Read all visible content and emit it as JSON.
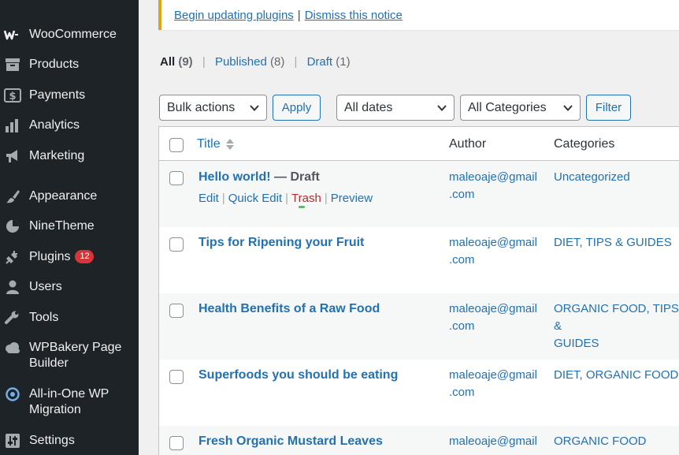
{
  "sidebar": {
    "items": [
      {
        "label": "WooCommerce",
        "icon": "woocommerce-icon"
      },
      {
        "label": "Products",
        "icon": "archive-icon"
      },
      {
        "label": "Payments",
        "icon": "dollar-icon"
      },
      {
        "label": "Analytics",
        "icon": "chart-bar-icon"
      },
      {
        "label": "Marketing",
        "icon": "megaphone-icon"
      },
      {
        "label": "Appearance",
        "icon": "paintbrush-icon"
      },
      {
        "label": "NineTheme",
        "icon": "pie-chart-icon"
      },
      {
        "label": "Plugins",
        "icon": "plugin-icon",
        "badge": "12"
      },
      {
        "label": "Users",
        "icon": "users-icon"
      },
      {
        "label": "Tools",
        "icon": "wrench-icon"
      },
      {
        "label": "WPBakery Page Builder",
        "label_line1": "WPBakery Page",
        "label_line2": "Builder",
        "icon": "cloud-icon"
      },
      {
        "label": "All-in-One WP Migration",
        "label_line1": "All-in-One WP",
        "label_line2": "Migration",
        "icon": "migration-icon"
      },
      {
        "label": "Settings",
        "icon": "settings-sliders-icon"
      }
    ]
  },
  "notice": {
    "update_link": "Begin updating plugins",
    "separator": "|",
    "dismiss_link": "Dismiss this notice"
  },
  "views": {
    "all_label": "All",
    "all_count": "(9)",
    "published_label": "Published",
    "published_count": "(8)",
    "draft_label": "Draft",
    "draft_count": "(1)",
    "separator": "|"
  },
  "filters": {
    "bulk_actions": "Bulk actions",
    "apply": "Apply",
    "dates": "All dates",
    "categories": "All Categories",
    "filter": "Filter"
  },
  "table": {
    "headers": {
      "title": "Title",
      "author": "Author",
      "categories": "Categories"
    },
    "rows": [
      {
        "title": "Hello world!",
        "state": " — Draft",
        "author_line1": "maleoaje@gmail",
        "author_line2": ".com",
        "categories_line1": "Uncategorized",
        "categories_line2": "",
        "actions": {
          "edit": "Edit",
          "quick_edit": "Quick Edit",
          "trash": "Trash",
          "preview": "Preview",
          "separator": "|"
        }
      },
      {
        "title": "Tips for Ripening your Fruit",
        "state": "",
        "author_line1": "maleoaje@gmail",
        "author_line2": ".com",
        "categories_line1": "DIET, TIPS & GUIDES",
        "categories_line2": ""
      },
      {
        "title": "Health Benefits of a Raw Food",
        "state": "",
        "author_line1": "maleoaje@gmail",
        "author_line2": ".com",
        "categories_line1": "ORGANIC FOOD, TIPS &",
        "categories_line2": "GUIDES"
      },
      {
        "title": "Superfoods you should be eating",
        "state": "",
        "author_line1": "maleoaje@gmail",
        "author_line2": ".com",
        "categories_line1": "DIET, ORGANIC FOOD",
        "categories_line2": ""
      },
      {
        "title": "Fresh Organic Mustard Leaves",
        "state": "",
        "author_line1": "maleoaje@gmail",
        "author_line2": "",
        "categories_line1": "ORGANIC FOOD",
        "categories_line2": ""
      }
    ]
  },
  "colors": {
    "sidebar_bg": "#1d2327",
    "link": "#2271b1",
    "trash": "#b32d2e",
    "badge": "#d63638",
    "notice_border": "#dba617"
  }
}
